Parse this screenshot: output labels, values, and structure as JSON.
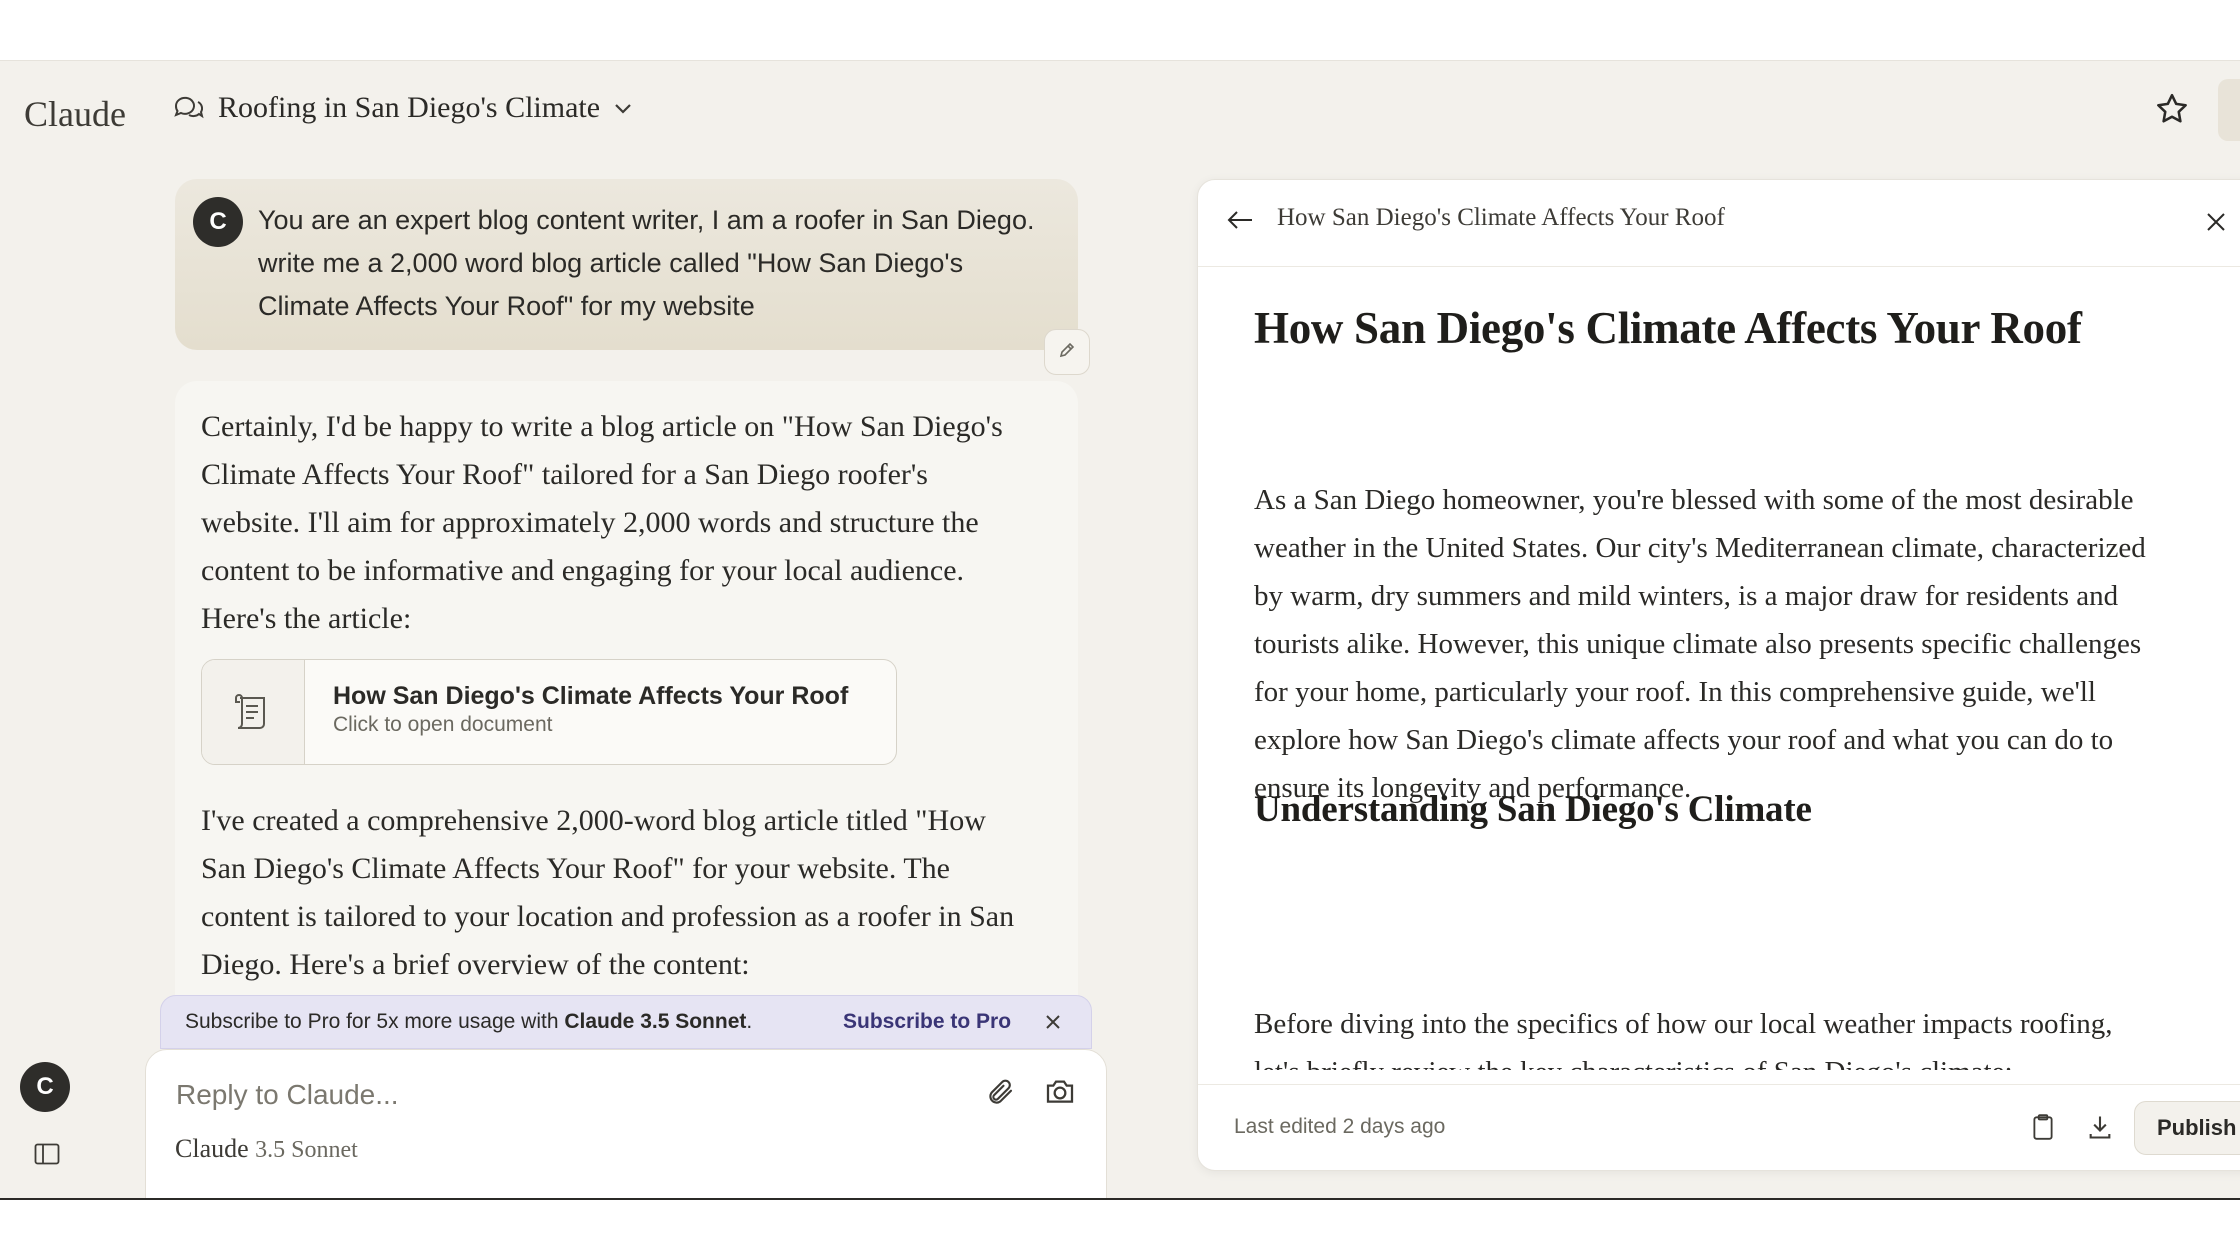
{
  "app": {
    "logo": "Claude"
  },
  "header": {
    "chat_title": "Roofing in San Diego's Climate",
    "icons": [
      "chat-bubbles-icon",
      "chevron-down-icon",
      "star-icon"
    ]
  },
  "user": {
    "initial": "C"
  },
  "user_message": "You are an expert blog content writer, I am a roofer in San Diego. write me a 2,000 word blog article called \"How San Diego's Climate Affects Your Roof\" for my website",
  "assistant": {
    "intro": "Certainly, I'd be happy to write a blog article on \"How San Diego's Climate Affects Your Roof\" tailored for a San Diego roofer's website. I'll aim for approximately 2,000 words and structure the content to be informative and engaging for your local audience. Here's the article:",
    "artifact": {
      "title": "How San Diego's Climate Affects Your Roof",
      "subtitle": "Click to open document"
    },
    "followup": "I've created a comprehensive 2,000-word blog article titled \"How San Diego's Climate Affects Your Roof\" for your website. The content is tailored to your location and profession as a roofer in San Diego. Here's a brief overview of the content:"
  },
  "promo": {
    "text": "Subscribe to Pro for 5x more usage with ",
    "model": "Claude 3.5 Sonnet",
    "text_end": ".",
    "cta": "Subscribe to Pro"
  },
  "composer": {
    "placeholder": "Reply to Claude...",
    "model_name": "Claude",
    "model_version": "3.5 Sonnet"
  },
  "document": {
    "panel_title": "How San Diego's Climate Affects Your Roof",
    "h1": "How San Diego's Climate Affects Your Roof",
    "p1": "As a San Diego homeowner, you're blessed with some of the most desirable weather in the United States. Our city's Mediterranean climate, characterized by warm, dry summers and mild winters, is a major draw for residents and tourists alike. However, this unique climate also presents specific challenges for your home, particularly your roof. In this comprehensive guide, we'll explore how San Diego's climate affects your roof and what you can do to ensure its longevity and performance.",
    "h2": "Understanding San Diego's Climate",
    "p2": "Before diving into the specifics of how our local weather impacts roofing, let's briefly review the key characteristics of San Diego's climate:",
    "last_edited": "Last edited 2 days ago",
    "publish": "Publish"
  },
  "colors": {
    "background": "#f3f1ec",
    "user_bubble": "#e8e3d6",
    "promo_bg": "#e6e4f3",
    "promo_cta": "#3a3576",
    "avatar": "#2e2d2a"
  }
}
